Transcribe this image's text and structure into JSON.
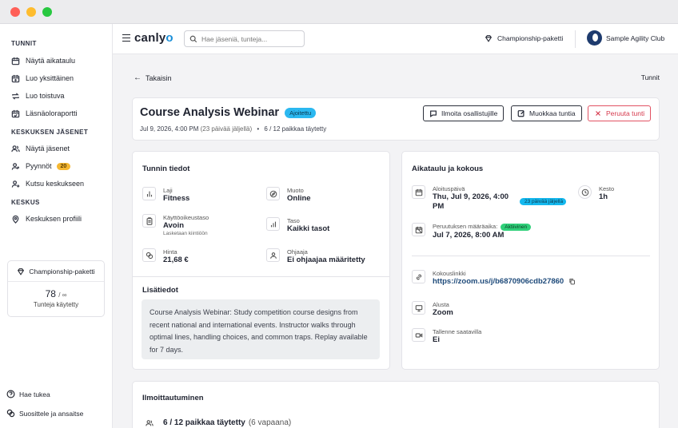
{
  "sidebar": {
    "sections": [
      {
        "title": "TUNNIT",
        "items": [
          "Näytä aikataulu",
          "Luo yksittäinen",
          "Luo toistuva",
          "Läsnäoloraportti"
        ]
      },
      {
        "title": "KESKUKSEN JÄSENET",
        "items": [
          "Näytä jäsenet",
          "Pyynnöt",
          "Kutsu keskukseen"
        ]
      },
      {
        "title": "KESKUS",
        "items": [
          "Keskuksen profiili"
        ]
      }
    ],
    "requests_badge": "20",
    "package": {
      "name": "Championship-paketti",
      "used": "78",
      "limit": "/ ∞",
      "label": "Tunteja käytetty"
    },
    "footer": [
      "Hae tukea",
      "Suosittele ja ansaitse"
    ]
  },
  "topbar": {
    "logo_main": "canly",
    "logo_accent": "o",
    "search_placeholder": "Hae jäseniä, tunteja...",
    "plan": "Championship-paketti",
    "club": "Sample Agility Club"
  },
  "page": {
    "back": "Takaisin",
    "breadcrumb": "Tunnit",
    "title": "Course Analysis Webinar",
    "status": "Ajoitettu",
    "meta_date": "Jul 9, 2026, 4:00 PM",
    "meta_days": "(23 päivää jäljellä)",
    "meta_sep": "•",
    "meta_capacity": "6 / 12 paikkaa täytetty",
    "buttons": {
      "notify": "Ilmoita osallistujille",
      "edit": "Muokkaa tuntia",
      "cancel": "Peruuta tunti"
    }
  },
  "details": {
    "heading": "Tunnin tiedot",
    "fields": [
      {
        "label": "Laji",
        "value": "Fitness",
        "icon": "chart-icon"
      },
      {
        "label": "Muoto",
        "value": "Online",
        "icon": "compass-icon"
      },
      {
        "label": "Käyttöoikeustaso",
        "value": "Avoin",
        "sub": "Lasketaan kiintiöön",
        "icon": "clipboard-icon"
      },
      {
        "label": "Taso",
        "value": "Kaikki tasot",
        "icon": "bars-icon"
      },
      {
        "label": "Hinta",
        "value": "21,68 €",
        "icon": "coins-icon"
      },
      {
        "label": "Ohjaaja",
        "value": "Ei ohjaajaa määritetty",
        "icon": "user-icon"
      }
    ],
    "extra_heading": "Lisätiedot",
    "description": "Course Analysis Webinar: Study competition course designs from recent national and international events. Instructor walks through optimal lines, handling choices, and common traps. Replay available for 7 days."
  },
  "schedule": {
    "heading": "Aikataulu ja kokous",
    "start_label": "Aloituspäivä",
    "start_value": "Thu, Jul 9, 2026, 4:00 PM",
    "start_badge": "23 päivää jäljellä",
    "duration_label": "Kesto",
    "duration_value": "1h",
    "deadline_label": "Peruutuksen määräaika:",
    "deadline_badge": "Aktiivinen",
    "deadline_value": "Jul 7, 2026, 8:00 AM",
    "link_label": "Kokouslinkki",
    "link_value": "https://zoom.us/j/b6870906cdb27860",
    "platform_label": "Alusta",
    "platform_value": "Zoom",
    "recording_label": "Tallenne saatavilla",
    "recording_value": "Ei"
  },
  "registration": {
    "heading": "Ilmoittautuminen",
    "filled": "6 / 12 paikkaa täytetty",
    "free": "(6 vapaana)"
  }
}
